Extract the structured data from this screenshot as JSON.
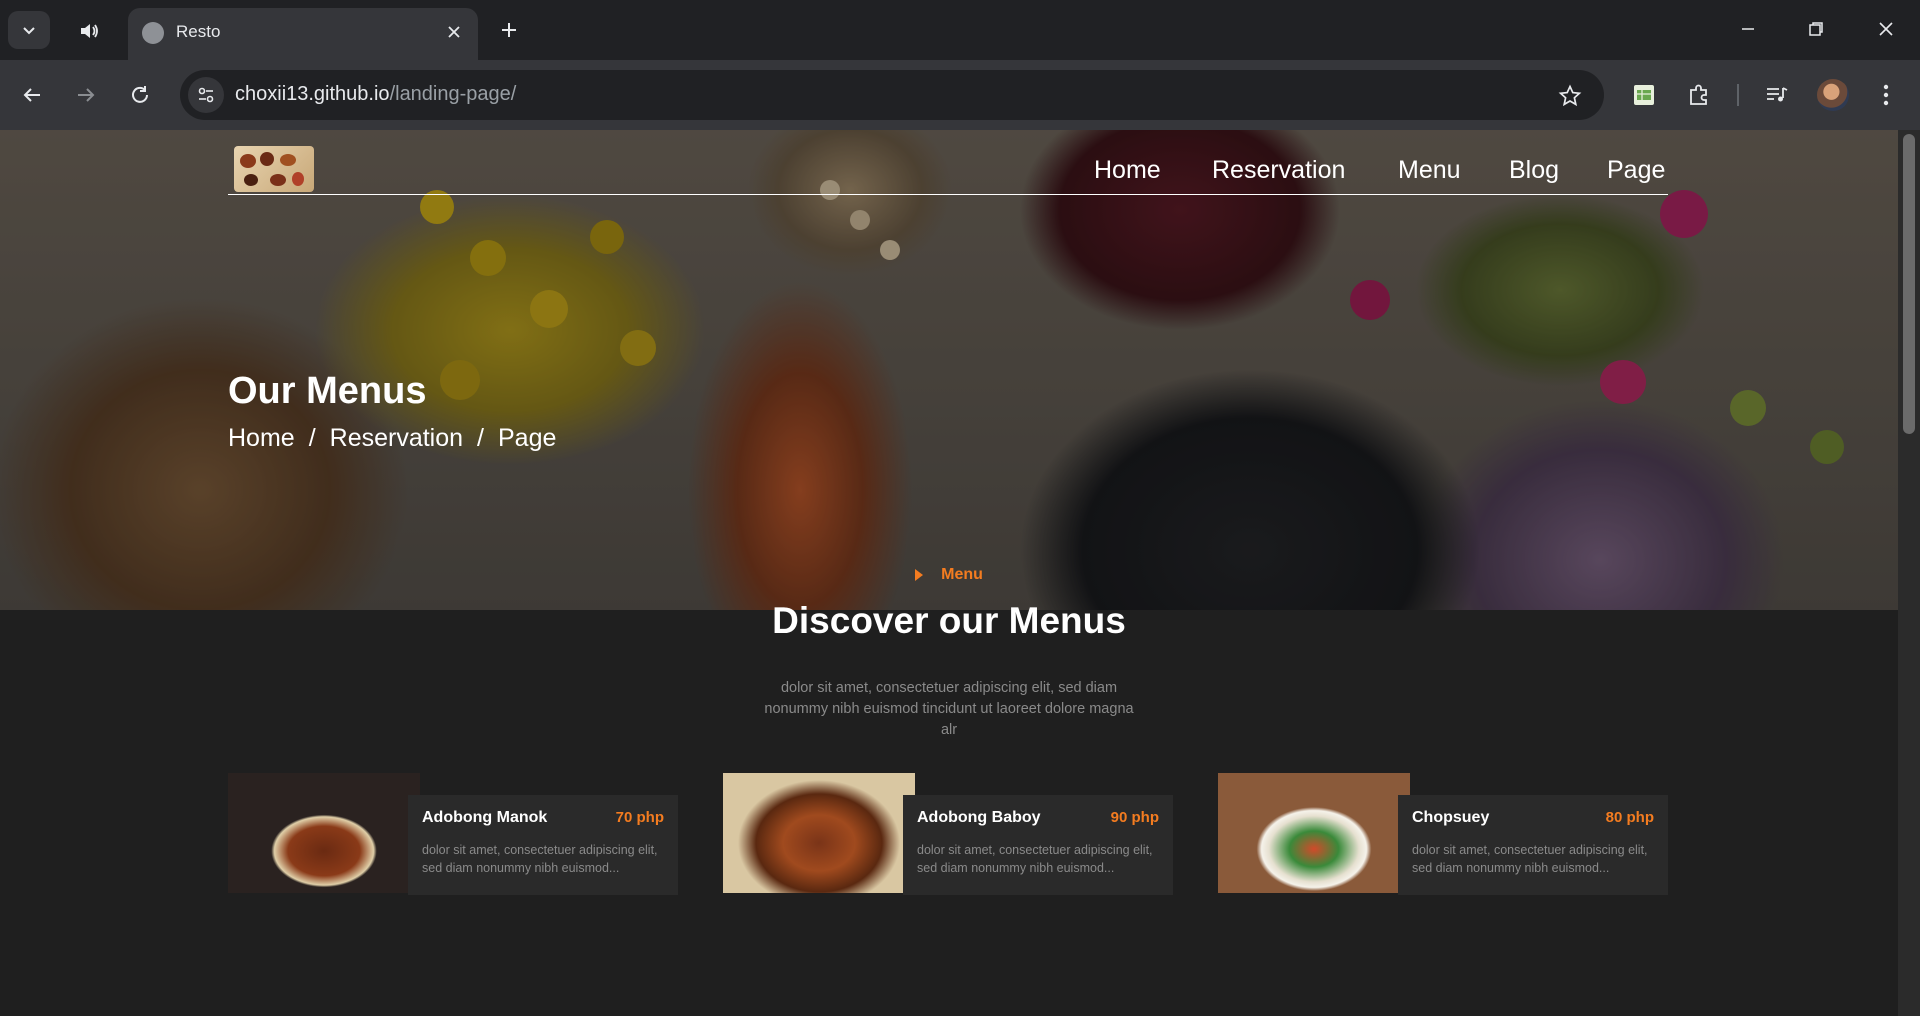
{
  "browser": {
    "tab_title": "Resto",
    "url_host": "choxii13.github.io",
    "url_path": "/landing-page/"
  },
  "site": {
    "nav": [
      "Home",
      "Reservation",
      "Menu",
      "Blog",
      "Page"
    ],
    "hero": {
      "title": "Our Menus",
      "breadcrumb": [
        "Home",
        "/",
        "Reservation",
        "/",
        "Page"
      ]
    },
    "section": {
      "tag": "Menu",
      "title": "Discover our Menus",
      "description": "dolor sit amet, consectetuer adipiscing elit, sed diam nonummy nibh euismod tincidunt ut laoreet dolore magna alr"
    },
    "cards": [
      {
        "name": "Adobong Manok",
        "price": "70 php",
        "description": "dolor sit amet, consectetuer adipiscing elit, sed diam nonummy nibh euismod..."
      },
      {
        "name": "Adobong Baboy",
        "price": "90 php",
        "description": "dolor sit amet, consectetuer adipiscing elit, sed diam nonummy nibh euismod..."
      },
      {
        "name": "Chopsuey",
        "price": "80 php",
        "description": "dolor sit amet, consectetuer adipiscing elit, sed diam nonummy nibh euismod..."
      }
    ]
  },
  "colors": {
    "accent": "#f47c20",
    "page_bg": "#1f1f1f",
    "card_bg": "#2a2a2a",
    "chrome_bg": "#202124",
    "toolbar_bg": "#35363a"
  },
  "icons": {
    "tab_search": "chevron-down-icon",
    "tab_audio": "speaker-icon",
    "tab_close": "close-icon",
    "new_tab": "plus-icon",
    "minimize": "minimize-icon",
    "restore": "restore-icon",
    "close_window": "close-icon",
    "back": "back-arrow-icon",
    "forward": "forward-arrow-icon",
    "reload": "reload-icon",
    "site_info": "tune-icon",
    "bookmark": "star-icon",
    "extensions": [
      "sheets-extension-icon",
      "puzzle-icon",
      "media-control-icon"
    ],
    "menu": "kebab-menu-icon"
  }
}
